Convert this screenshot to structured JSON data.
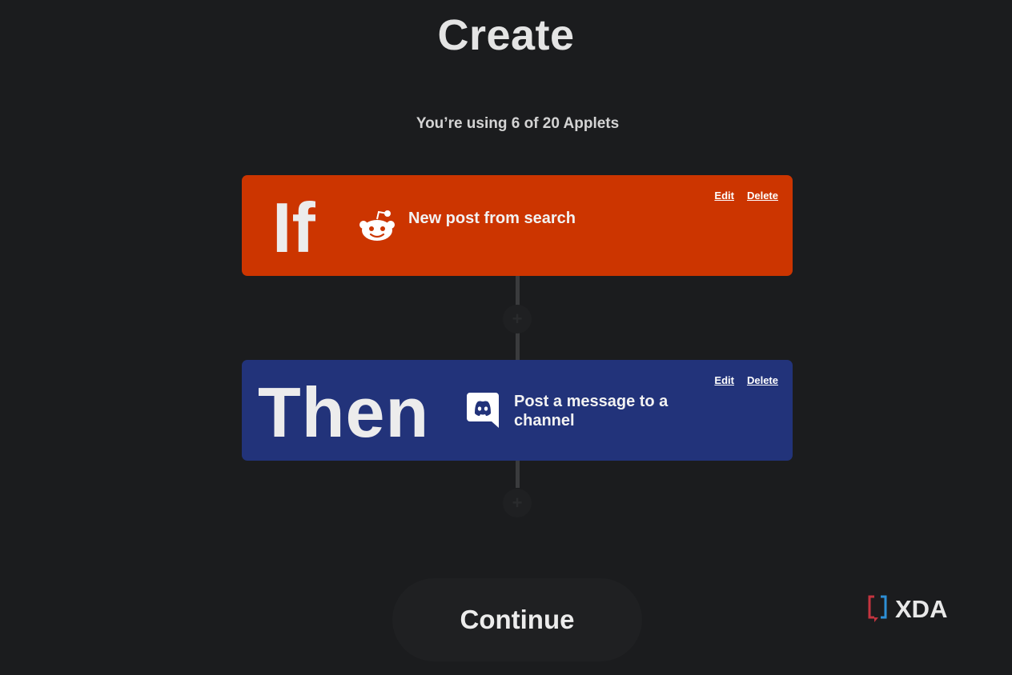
{
  "header": {
    "title": "Create",
    "usage_text": "You’re using 6 of 20 Applets"
  },
  "trigger": {
    "keyword": "If",
    "service_icon": "reddit-icon",
    "label": "New post from search",
    "edit_label": "Edit",
    "delete_label": "Delete",
    "color": "#cc3500"
  },
  "action": {
    "keyword": "Then",
    "service_icon": "discord-icon",
    "label": "Post a message to a channel",
    "edit_label": "Edit",
    "delete_label": "Delete",
    "color": "#22337a"
  },
  "add_step": {
    "icon": "plus-icon",
    "glyph": "+"
  },
  "footer": {
    "continue_label": "Continue"
  },
  "watermark": {
    "text": "XDA",
    "icon": "xda-logo"
  }
}
